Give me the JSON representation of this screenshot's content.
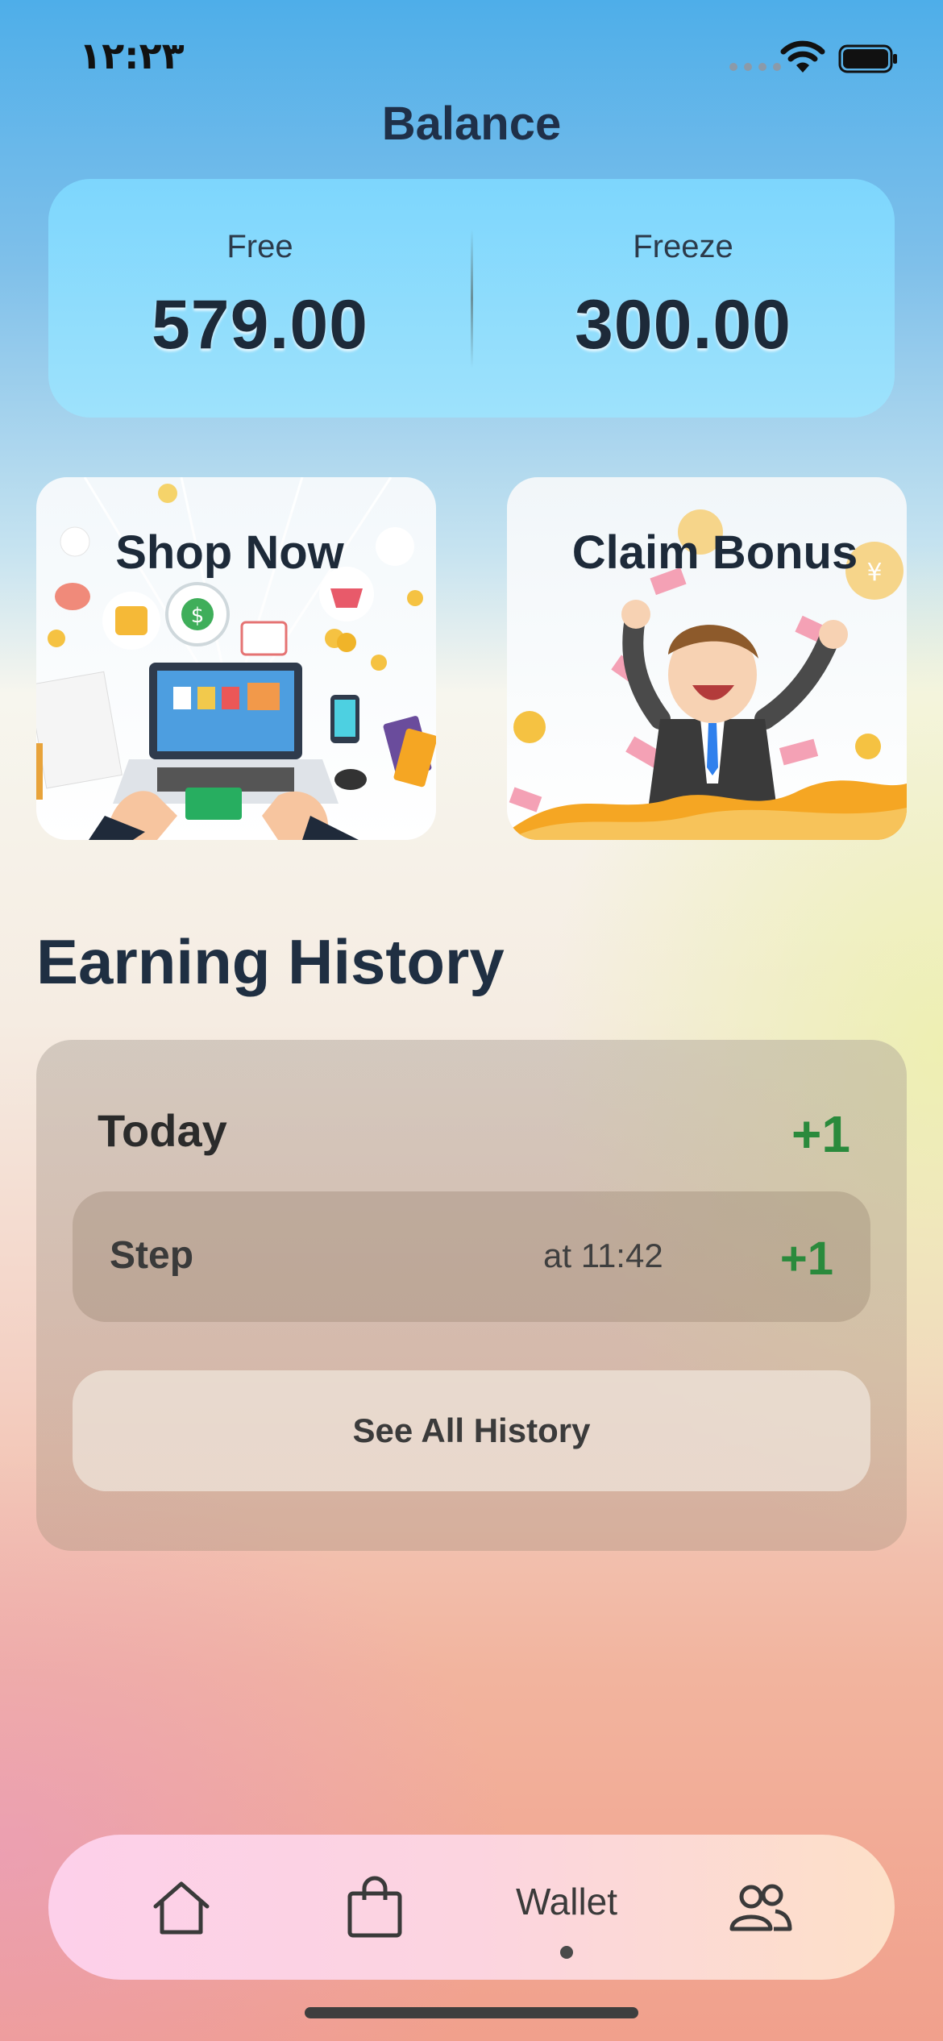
{
  "status_bar": {
    "time": "۱۲:۲۳"
  },
  "header": {
    "title": "Balance"
  },
  "balance": {
    "free_label": "Free",
    "free_value": "579.00",
    "freeze_label": "Freeze",
    "freeze_value": "300.00"
  },
  "promos": {
    "shop_label": "Shop Now",
    "bonus_label": "Claim Bonus"
  },
  "earning_history": {
    "title": "Earning History",
    "group_label": "Today",
    "group_total": "+1",
    "entries": [
      {
        "name": "Step",
        "time": "at 11:42",
        "value": "+1"
      }
    ],
    "see_all_label": "See All History"
  },
  "tab_bar": {
    "tabs": [
      {
        "icon": "home-icon"
      },
      {
        "icon": "shopping-bag-icon"
      },
      {
        "label": "Wallet",
        "selected": true
      },
      {
        "icon": "people-icon"
      }
    ]
  },
  "colors": {
    "positive": "#2a8a3c",
    "balance_card": "#8fdcfc"
  }
}
